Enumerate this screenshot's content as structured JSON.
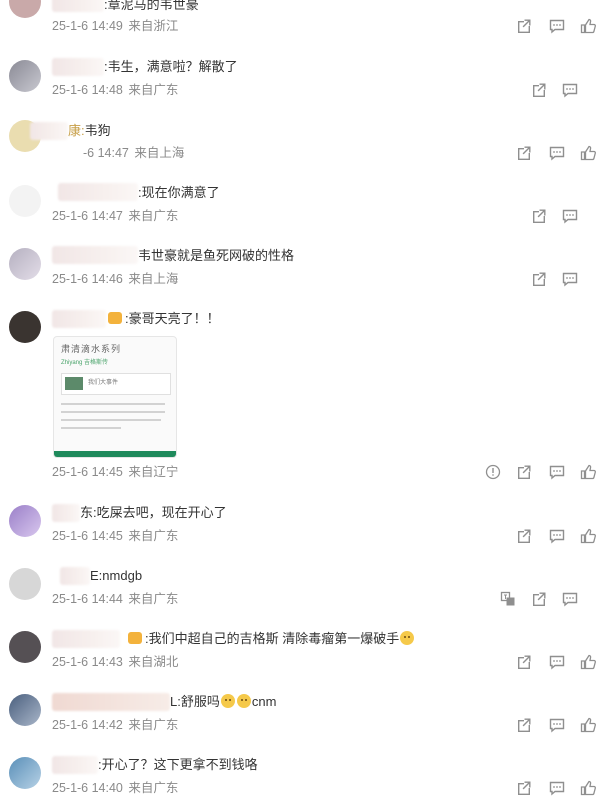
{
  "comments": [
    {
      "name_suffix": ":",
      "text": "章泥马的韦世豪",
      "time": "25-1-6 14:49",
      "location": "来自浙江"
    },
    {
      "name_suffix": ":",
      "text": "韦生，满意啦？解散了",
      "time": "25-1-6 14:48",
      "location": "来自广东"
    },
    {
      "name_suffix": "康:",
      "text": "韦狗",
      "time": "-6 14:47",
      "location": "来自上海"
    },
    {
      "name_suffix": ":",
      "text": "现在你满意了",
      "time": "25-1-6 14:47",
      "location": "来自广东"
    },
    {
      "name_suffix": "",
      "text": "韦世豪就是鱼死网破的性格",
      "time": "25-1-6 14:46",
      "location": "来自上海"
    },
    {
      "name_suffix": ":",
      "text": "豪哥天亮了！！",
      "time": "25-1-6 14:45",
      "location": "来自辽宁"
    },
    {
      "name_suffix": "东:",
      "text": "吃屎去吧，现在开心了",
      "time": "25-1-6 14:45",
      "location": "来自广东"
    },
    {
      "name_suffix": "E:",
      "text": "nmdgb",
      "time": "25-1-6 14:44",
      "location": "来自广东"
    },
    {
      "name_suffix": ":",
      "text": "我们中超自己的吉格斯 清除毒瘤第一爆破手",
      "time": "25-1-6 14:43",
      "location": "来自湖北"
    },
    {
      "name_suffix": "L:",
      "text": "舒服吗",
      "text_after": "cnm",
      "time": "25-1-6 14:42",
      "location": "来自广东"
    },
    {
      "name_suffix": ":",
      "text": "开心了？这下更拿不到钱咯",
      "time": "25-1-6 14:40",
      "location": "来自广东"
    }
  ],
  "card": {
    "title": "肃清滴水系列",
    "subtitle": "Zhiyang 吉格斯传",
    "box_text": "我们大事件"
  },
  "colors": {
    "text": "#333333",
    "meta": "#8a8a8a",
    "icon": "#8f8f8f"
  },
  "icons": [
    "share-icon",
    "comment-icon",
    "like-icon",
    "report-icon",
    "translate-icon"
  ]
}
